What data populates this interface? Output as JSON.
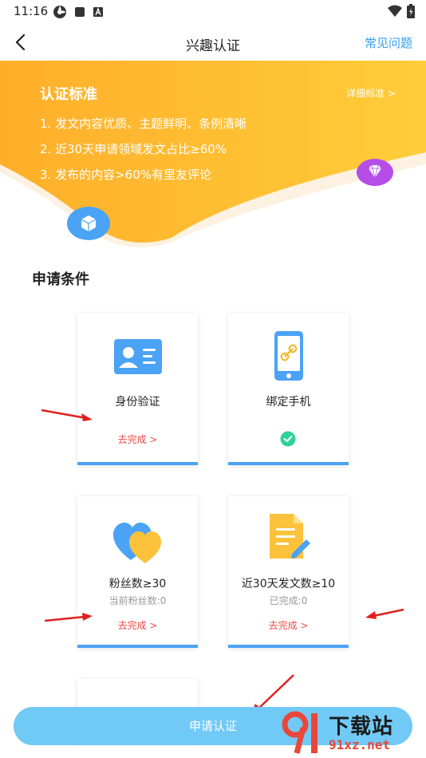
{
  "status_bar": {
    "time": "11:16"
  },
  "header": {
    "title": "兴趣认证",
    "faq": "常见问题"
  },
  "banner": {
    "title": "认证标准",
    "detail_link": "详细标准 >",
    "criteria": [
      "1. 发文内容优质、主题鲜明、条例清晰",
      "2. 近30天申请领域发文占比≥60%",
      "3. 发布的内容>60%有里友评论"
    ]
  },
  "section_title": "申请条件",
  "cards": [
    {
      "label": "身份验证",
      "action": "去完成 >"
    },
    {
      "label": "绑定手机"
    },
    {
      "label": "粉丝数≥30",
      "sub": "当前粉丝数:0",
      "action": "去完成 >"
    },
    {
      "label": "近30天发文数≥10",
      "sub": "已完成:0",
      "action": "去完成 >"
    }
  ],
  "submit_label": "申请认证",
  "watermark": {
    "brand": "下载站",
    "site": "91xz.net"
  },
  "colors": {
    "banner_orange": "#ffb733",
    "accent_blue": "#4aa3f5",
    "link_blue": "#2e9ff0",
    "action_red": "#f04848",
    "button_blue": "#71c9f5"
  }
}
